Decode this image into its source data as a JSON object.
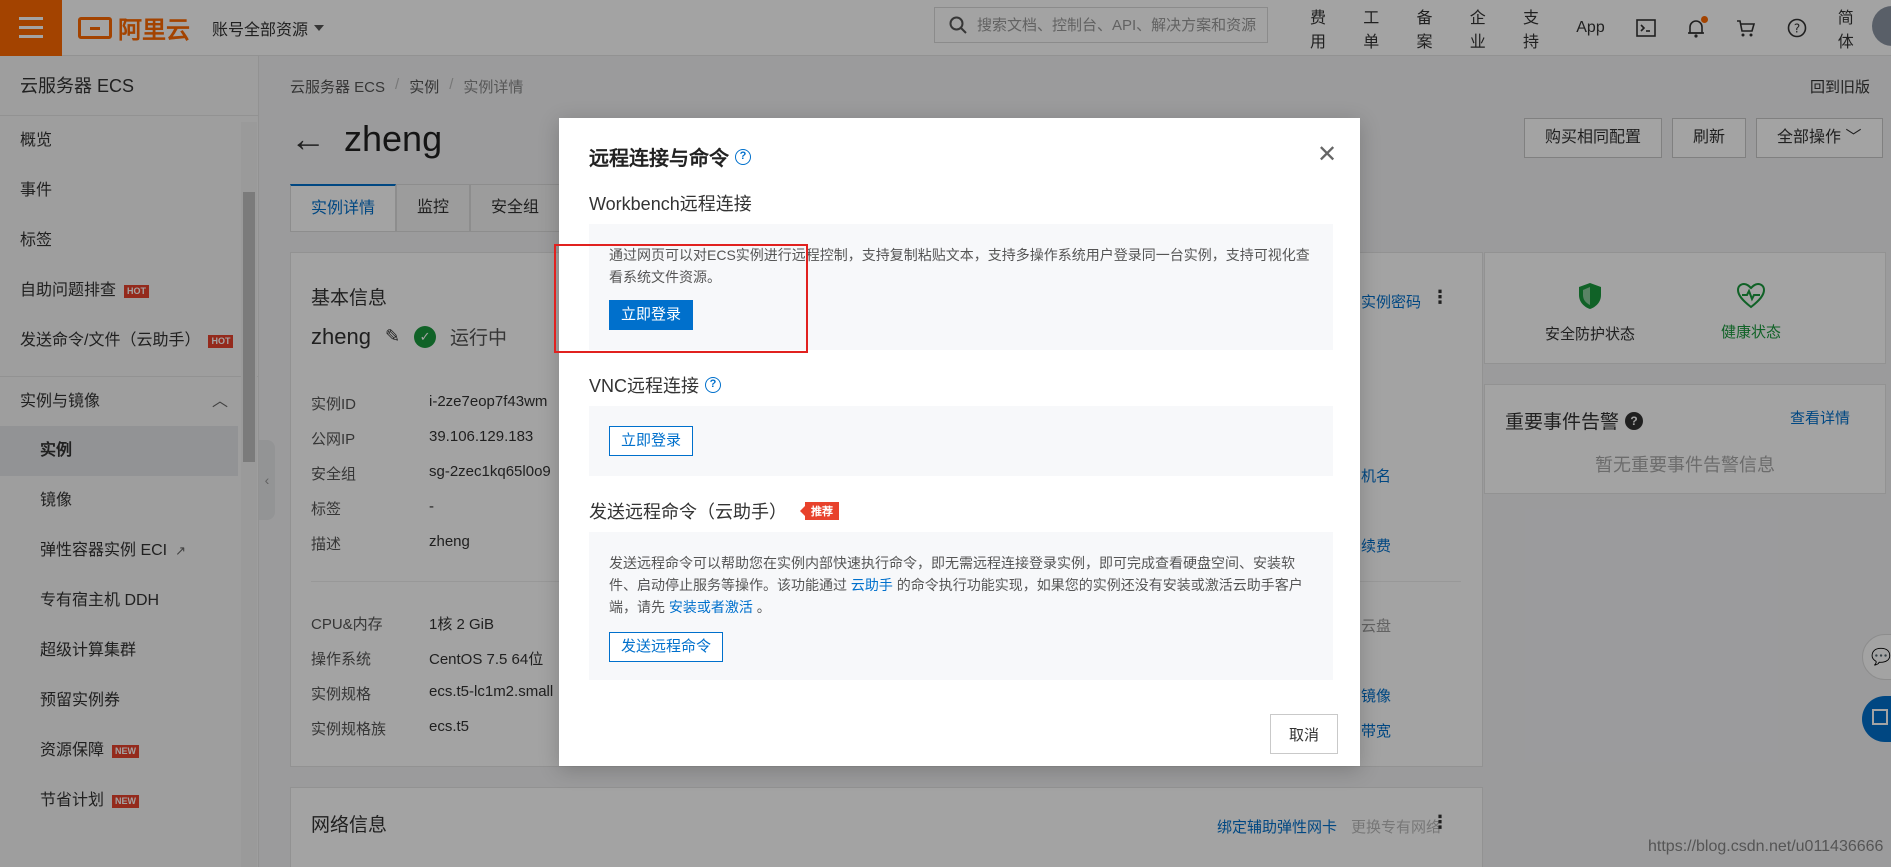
{
  "topbar": {
    "logo_text": "阿里云",
    "account_label": "账号全部资源",
    "search_placeholder": "搜索文档、控制台、API、解决方案和资源",
    "nav": [
      "费用",
      "工单",
      "备案",
      "企业",
      "支持",
      "App"
    ],
    "lang": "简体"
  },
  "sidebar": {
    "title": "云服务器 ECS",
    "items": [
      {
        "label": "概览"
      },
      {
        "label": "事件"
      },
      {
        "label": "标签"
      },
      {
        "label": "自助问题排查",
        "badge": "HOT"
      },
      {
        "label": "发送命令/文件（云助手）",
        "badge": "HOT"
      }
    ],
    "group": "实例与镜像",
    "sub_items": [
      {
        "label": "实例",
        "active": true
      },
      {
        "label": "镜像"
      },
      {
        "label": "弹性容器实例 ECI"
      },
      {
        "label": "专有宿主机 DDH"
      },
      {
        "label": "超级计算集群"
      },
      {
        "label": "预留实例券"
      },
      {
        "label": "资源保障",
        "badge": "NEW"
      },
      {
        "label": "节省计划",
        "badge": "NEW"
      }
    ]
  },
  "breadcrumb": [
    "云服务器 ECS",
    "实例",
    "实例详情"
  ],
  "old_version": "回到旧版",
  "page_title": "zheng",
  "actions": [
    "购买相同配置",
    "刷新",
    "全部操作"
  ],
  "tabs": [
    "实例详情",
    "监控",
    "安全组"
  ],
  "basic": {
    "title": "基本信息",
    "name": "zheng",
    "status": "运行中",
    "rows": [
      {
        "k": "实例ID",
        "v": "i-2ze7eop7f43wm"
      },
      {
        "k": "公网IP",
        "v": "39.106.129.183"
      },
      {
        "k": "安全组",
        "v": "sg-2zec1kq65l0o9"
      },
      {
        "k": "标签",
        "v": "-"
      },
      {
        "k": "描述",
        "v": "zheng"
      }
    ],
    "rows2": [
      {
        "k": "CPU&内存",
        "v": "1核 2 GiB"
      },
      {
        "k": "操作系统",
        "v": "CentOS 7.5 64位"
      },
      {
        "k": "实例规格",
        "v": "ecs.t5-lc1m2.small"
      },
      {
        "k": "实例规格族",
        "v": "ecs.t5"
      }
    ],
    "right_links": [
      "实例密码",
      "机名",
      "续费",
      "云盘",
      "镜像",
      "带宽"
    ]
  },
  "security": {
    "items": [
      "安全防护状态",
      "健康状态"
    ]
  },
  "events": {
    "title": "重要事件告警",
    "link": "查看详情",
    "empty": "暂无重要事件告警信息"
  },
  "network": {
    "title": "网络信息",
    "links": [
      "绑定辅助弹性网卡",
      "更换专有网络"
    ]
  },
  "modal": {
    "title": "远程连接与命令",
    "workbench": {
      "title": "Workbench远程连接",
      "desc": "通过网页可以对ECS实例进行远程控制，支持复制粘贴文本，支持多操作系统用户登录同一台实例，支持可视化查看系统文件资源。",
      "button": "立即登录"
    },
    "vnc": {
      "title": "VNC远程连接",
      "button": "立即登录"
    },
    "command": {
      "title": "发送远程命令（云助手）",
      "badge": "推荐",
      "desc_1": "发送远程命令可以帮助您在实例内部快速执行命令，即无需远程连接登录实例，即可完成查看硬盘空间、安装软件、启动停止服务等操作。该功能通过",
      "link_1": "云助手",
      "desc_2": "的命令执行功能实现，如果您的实例还没有安装或激活云助手客户端，请先",
      "link_2": "安装或者激活",
      "desc_3": "。",
      "button": "发送远程命令"
    },
    "cancel": "取消"
  },
  "watermark": "https://blog.csdn.net/u011436666",
  "colors": {
    "brand": "#ff6a00",
    "primary": "#0070cc",
    "highlight": "#e1211f",
    "success": "#1a9a3d"
  }
}
